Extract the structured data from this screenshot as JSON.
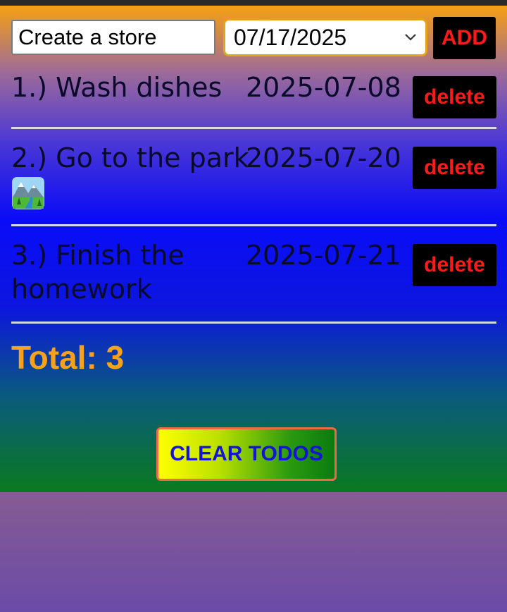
{
  "form": {
    "task_value": "Create a store",
    "date_value": "07/17/2025",
    "add_label": "ADD"
  },
  "todos": [
    {
      "index": "1.)",
      "name": "1.) Wash dishes",
      "date": "2025-07-08",
      "delete_label": "delete"
    },
    {
      "index": "2.)",
      "name": "2.) Go to the park",
      "date": "2025-07-20",
      "delete_label": "delete",
      "emoji": "national-park-icon"
    },
    {
      "index": "3.)",
      "name": "3.) Finish the homework",
      "date": "2025-07-21",
      "delete_label": "delete"
    }
  ],
  "summary": {
    "total_text": "Total: 3"
  },
  "footer": {
    "clear_label": "CLEAR TODOS"
  },
  "colors": {
    "accent_orange": "#f7a21b",
    "delete_text": "#ff1a1a",
    "clear_text": "#1414d8"
  }
}
